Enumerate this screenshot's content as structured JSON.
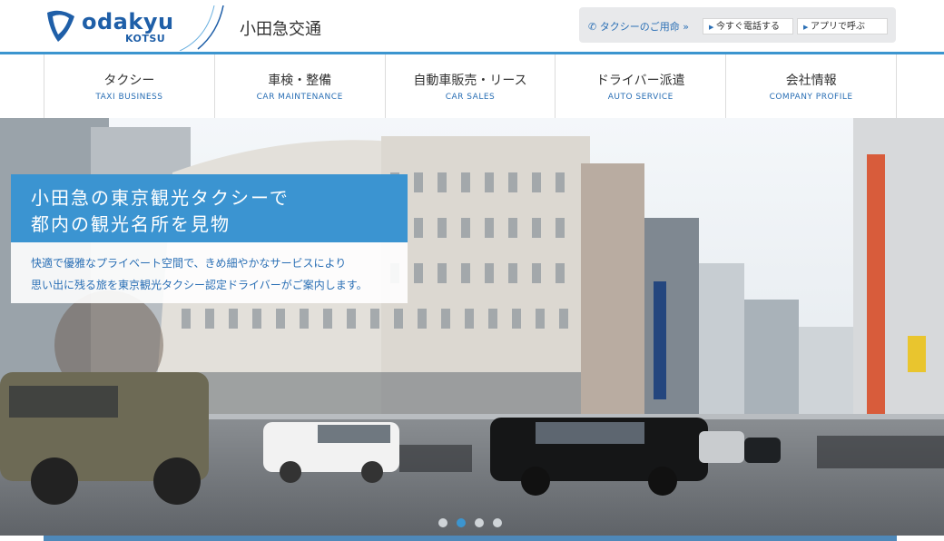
{
  "header": {
    "logo_word": "odakyu",
    "logo_sub": "KOTSU",
    "company_name": "小田急交通"
  },
  "utility": {
    "label": "タクシーのご用命",
    "call_now": "今すぐ電話する",
    "app_call": "アプリで呼ぶ"
  },
  "nav": {
    "items": [
      {
        "ja": "タクシー",
        "en": "TAXI BUSINESS"
      },
      {
        "ja": "車検・整備",
        "en": "CAR MAINTENANCE"
      },
      {
        "ja": "自動車販売・リース",
        "en": "CAR SALES"
      },
      {
        "ja": "ドライバー派遣",
        "en": "AUTO SERVICE"
      },
      {
        "ja": "会社情報",
        "en": "COMPANY PROFILE"
      }
    ]
  },
  "hero": {
    "headline_line1": "小田急の東京観光タクシーで",
    "headline_line2": "都内の観光名所を見物",
    "sub_line1": "快適で優雅なプライベート空間で、きめ細やかなサービスにより",
    "sub_line2": "思い出に残る旅を東京観光タクシー認定ドライバーがご案内します。",
    "slides": 4,
    "active_slide": 2
  },
  "colors": {
    "accent": "#3c95cf",
    "brand": "#1f5fa8",
    "headline_bg": "#3b94d1"
  }
}
